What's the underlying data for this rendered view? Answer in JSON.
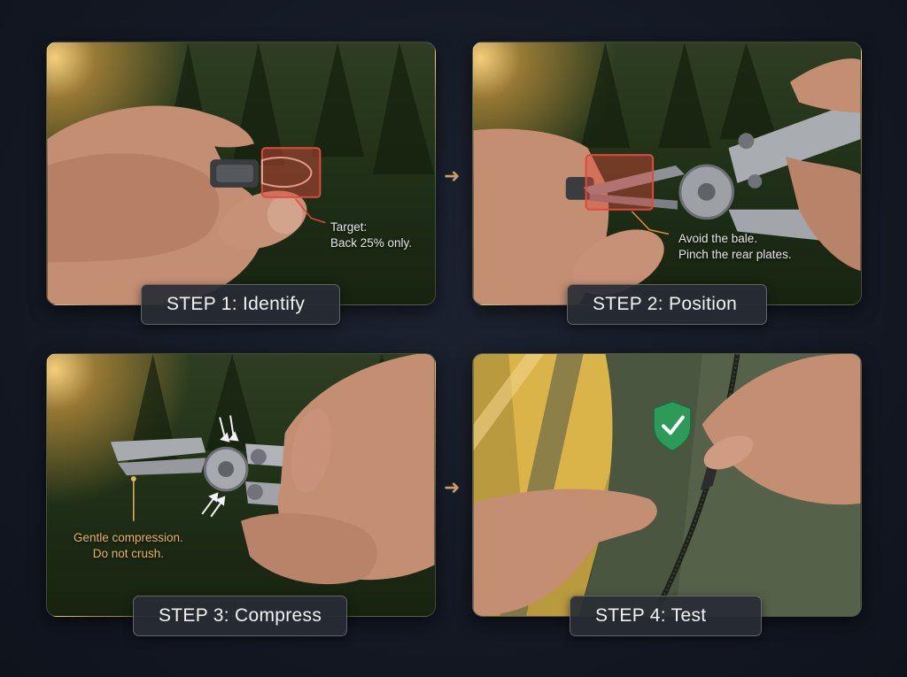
{
  "steps": [
    {
      "label": "STEP 1: Identify",
      "note_line1": "Target:",
      "note_line2": "Back 25% only."
    },
    {
      "label": "STEP 2: Position",
      "note_line1": "Avoid the bale.",
      "note_line2": "Pinch the rear plates."
    },
    {
      "label": "STEP 3: Compress",
      "note_line1": "Gentle compression.",
      "note_line2": "Do not crush."
    },
    {
      "label": "STEP 4: Test"
    }
  ],
  "colors": {
    "background": "#141925",
    "highlight_red": "#e04a3a",
    "arrow_accent": "#c99b66",
    "note_amber": "#e9b45c",
    "shield_green": "#2e9a5a"
  },
  "icons": [
    "arrow-right-icon",
    "arrow-right-icon",
    "check-shield-icon",
    "compression-arrows-icon"
  ]
}
